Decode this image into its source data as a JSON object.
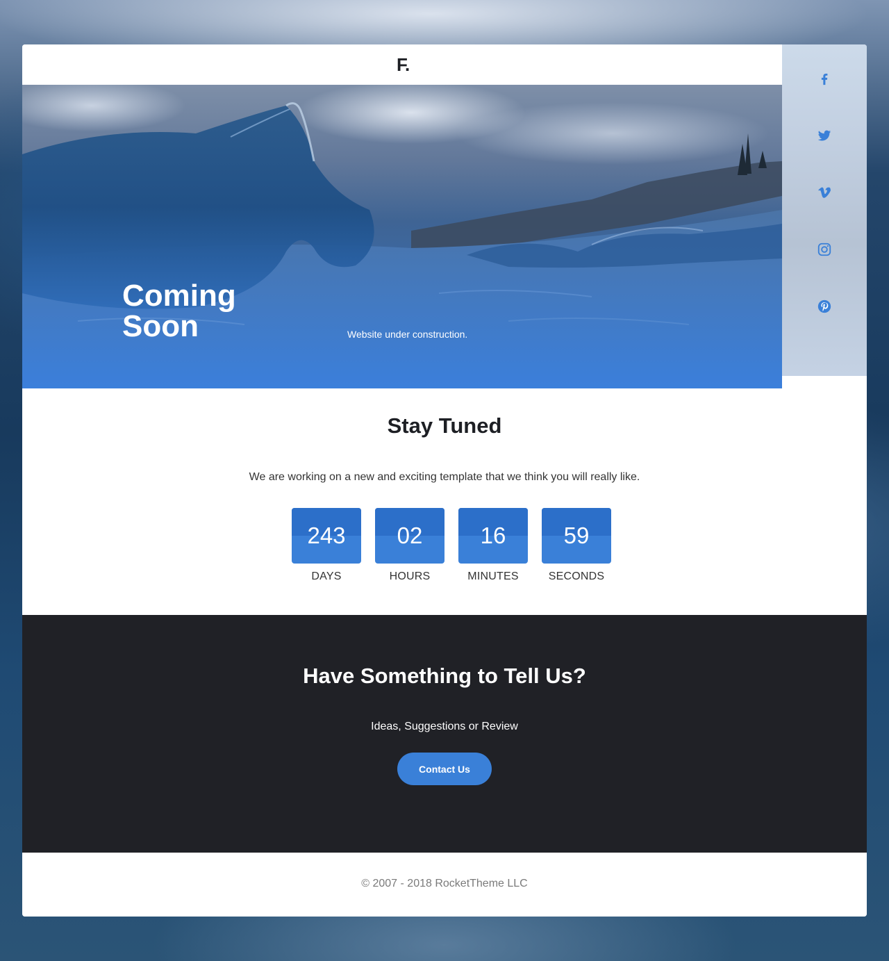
{
  "brand": {
    "logo_text": "F",
    "logo_dot": "."
  },
  "hero": {
    "title": "Coming Soon",
    "subtitle": "Website under construction."
  },
  "social": {
    "icon_color": "#3a80d8",
    "items": [
      {
        "name": "facebook-icon"
      },
      {
        "name": "twitter-icon"
      },
      {
        "name": "vimeo-icon"
      },
      {
        "name": "instagram-icon"
      },
      {
        "name": "pinterest-icon"
      }
    ]
  },
  "stay_tuned": {
    "title": "Stay Tuned",
    "text": "We are working on a new and exciting template that we think you will really like."
  },
  "countdown": [
    {
      "value": "243",
      "label": "DAYS"
    },
    {
      "value": "02",
      "label": "HOURS"
    },
    {
      "value": "16",
      "label": "MINUTES"
    },
    {
      "value": "59",
      "label": "SECONDS"
    }
  ],
  "contact": {
    "title": "Have Something to Tell Us?",
    "subtitle": "Ideas, Suggestions or Review",
    "button_label": "Contact Us"
  },
  "footer": {
    "copyright": "© 2007 - 2018 RocketTheme LLC"
  },
  "colors": {
    "accent": "#3a80d8",
    "dark": "#202126",
    "text": "#1d1f24"
  }
}
